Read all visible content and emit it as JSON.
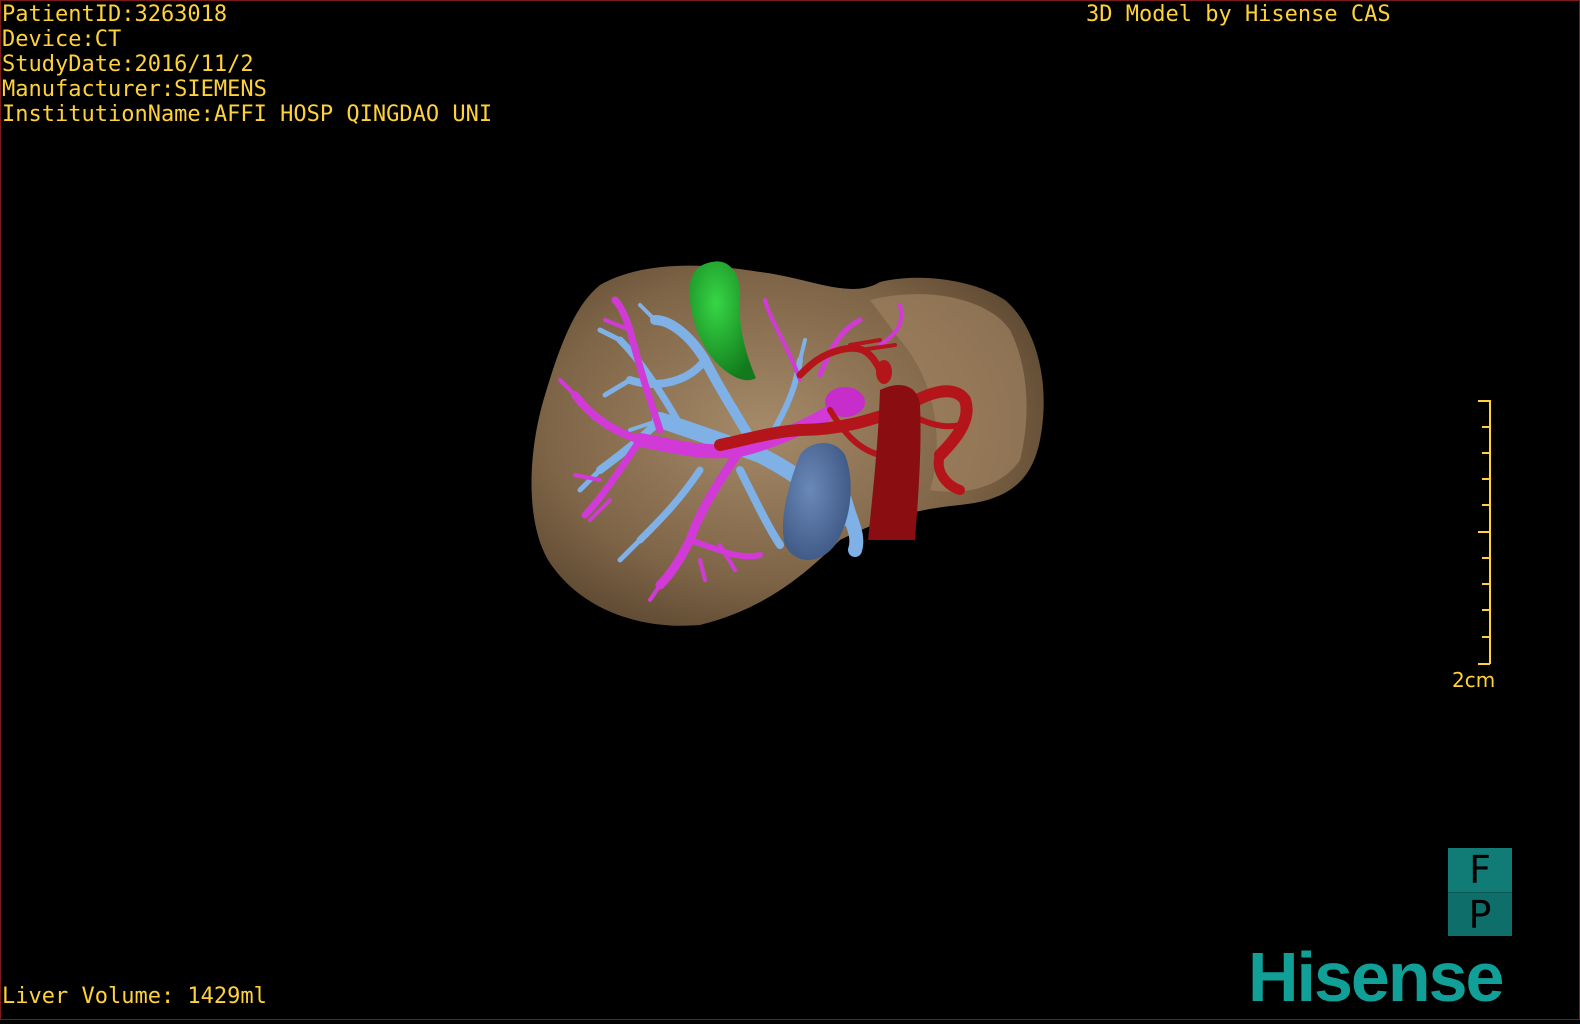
{
  "header": {
    "patient_id": "PatientID:3263018",
    "device": "Device:CT",
    "study_date": "StudyDate:2016/11/2",
    "manufacturer": "Manufacturer:SIEMENS",
    "institution": "InstitutionName:AFFI HOSP QINGDAO UNI",
    "brand_caption": "3D Model by Hisense CAS"
  },
  "footer": {
    "liver_volume": "Liver Volume: 1429ml"
  },
  "scale_bar": {
    "label": "2cm"
  },
  "orientation_cube": {
    "top": "F",
    "bottom": "P"
  },
  "logo": {
    "text": "Hisense"
  },
  "colors": {
    "overlay_text": "#ffd23a",
    "liver": "#8a6e4e",
    "gallbladder": "#1fae2c",
    "portal_vein": "#7fb0e6",
    "hepatic_vein": "#d23ad8",
    "artery": "#b3151a",
    "tumor": "#4f6f9f",
    "logo": "#11a098",
    "orientation_cube": "#117b76"
  },
  "model": {
    "structures": [
      "liver",
      "gallbladder",
      "portal-vein",
      "hepatic-vein",
      "hepatic-artery",
      "tumor"
    ]
  }
}
